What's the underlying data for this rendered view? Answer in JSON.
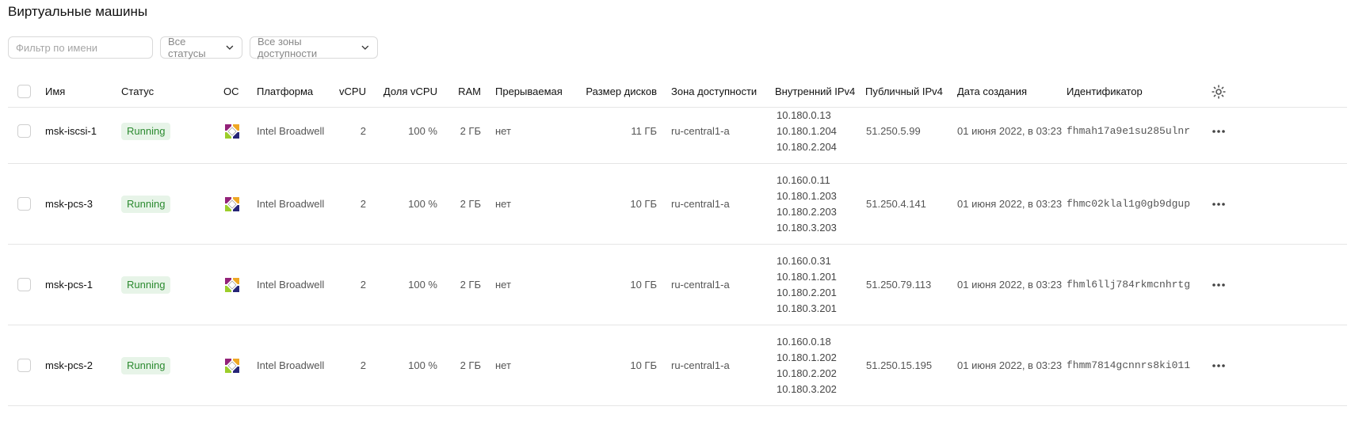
{
  "page": {
    "title": "Виртуальные машины"
  },
  "filters": {
    "name_placeholder": "Фильтр по имени",
    "status_select": "Все статусы",
    "zone_select": "Все зоны доступности"
  },
  "columns": {
    "name": "Имя",
    "status": "Статус",
    "os": "ОС",
    "platform": "Платформа",
    "vcpu": "vCPU",
    "vcpu_share": "Доля vCPU",
    "ram": "RAM",
    "preemptible": "Прерываемая",
    "disk_size": "Размер дисков",
    "zone": "Зона доступности",
    "internal_ip": "Внутренний IPv4",
    "public_ip": "Публичный IPv4",
    "created": "Дата создания",
    "id": "Идентификатор"
  },
  "rows": [
    {
      "name": "msk-iscsi-1",
      "status": "Running",
      "platform": "Intel Broadwell",
      "vcpu": "2",
      "vcpu_share": "100 %",
      "ram": "2 ГБ",
      "preemptible": "нет",
      "disk_size": "11 ГБ",
      "zone": "ru-central1-a",
      "internal_ips": [
        "10.180.0.13",
        "10.180.1.204",
        "10.180.2.204"
      ],
      "public_ip": "51.250.5.99",
      "created": "01 июня 2022, в 03:23",
      "id": "fhmah17a9e1su285ulnr"
    },
    {
      "name": "msk-pcs-3",
      "status": "Running",
      "platform": "Intel Broadwell",
      "vcpu": "2",
      "vcpu_share": "100 %",
      "ram": "2 ГБ",
      "preemptible": "нет",
      "disk_size": "10 ГБ",
      "zone": "ru-central1-a",
      "internal_ips": [
        "10.160.0.11",
        "10.180.1.203",
        "10.180.2.203",
        "10.180.3.203"
      ],
      "public_ip": "51.250.4.141",
      "created": "01 июня 2022, в 03:23",
      "id": "fhmc02klal1g0gb9dgup"
    },
    {
      "name": "msk-pcs-1",
      "status": "Running",
      "platform": "Intel Broadwell",
      "vcpu": "2",
      "vcpu_share": "100 %",
      "ram": "2 ГБ",
      "preemptible": "нет",
      "disk_size": "10 ГБ",
      "zone": "ru-central1-a",
      "internal_ips": [
        "10.160.0.31",
        "10.180.1.201",
        "10.180.2.201",
        "10.180.3.201"
      ],
      "public_ip": "51.250.79.113",
      "created": "01 июня 2022, в 03:23",
      "id": "fhml6llj784rkmcnhrtg"
    },
    {
      "name": "msk-pcs-2",
      "status": "Running",
      "platform": "Intel Broadwell",
      "vcpu": "2",
      "vcpu_share": "100 %",
      "ram": "2 ГБ",
      "preemptible": "нет",
      "disk_size": "10 ГБ",
      "zone": "ru-central1-a",
      "internal_ips": [
        "10.160.0.18",
        "10.180.1.202",
        "10.180.2.202",
        "10.180.3.202"
      ],
      "public_ip": "51.250.15.195",
      "created": "01 июня 2022, в 03:23",
      "id": "fhmm7814gcnnrs8ki011"
    }
  ],
  "colors": {
    "status_bg": "#e7f4e8",
    "status_fg": "#2b8a2f"
  }
}
